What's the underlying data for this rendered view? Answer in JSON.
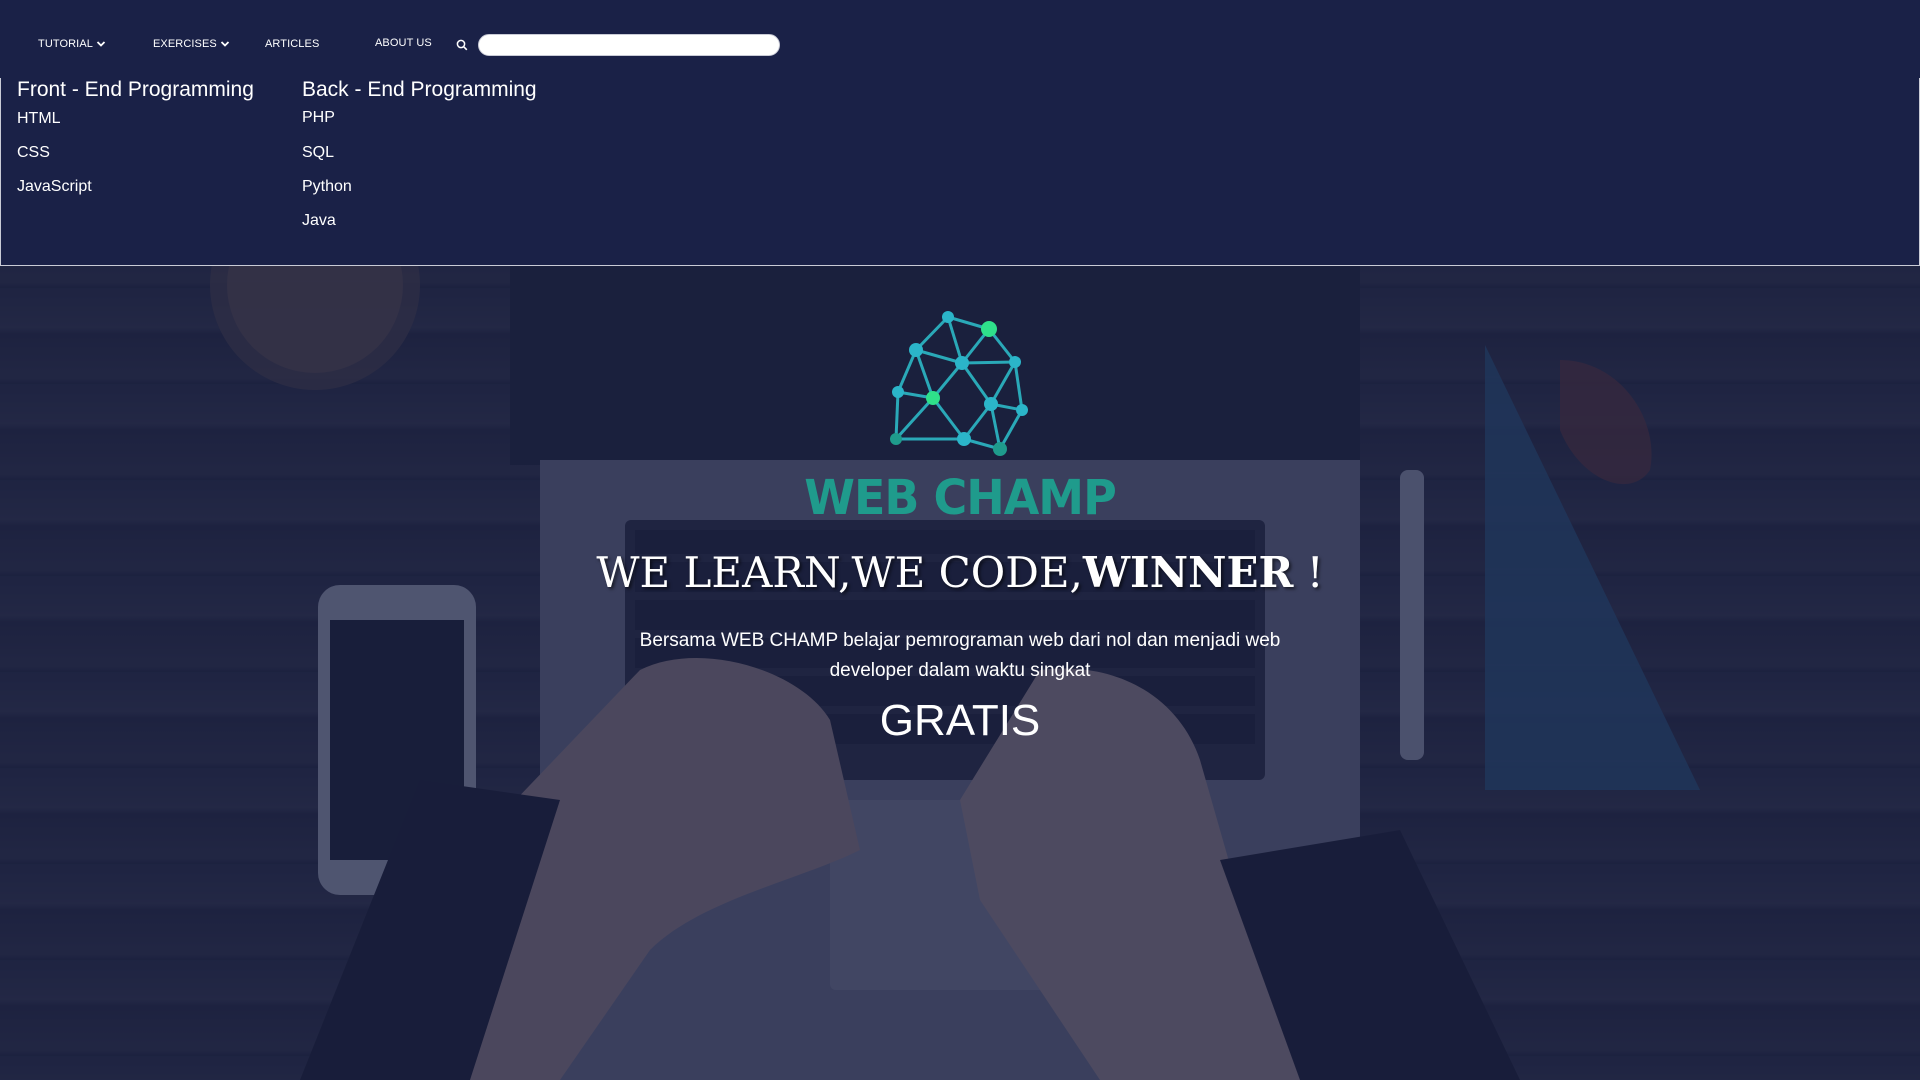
{
  "nav": {
    "items": [
      {
        "label": "TUTORIAL",
        "dropdown": true
      },
      {
        "label": "EXERCISES",
        "dropdown": true
      },
      {
        "label": "ARTICLES",
        "dropdown": false
      },
      {
        "label": "ABOUT US",
        "dropdown": false
      }
    ],
    "search": {
      "icon": "search-icon",
      "value": "",
      "placeholder": ""
    }
  },
  "dropdown": {
    "columns": [
      {
        "heading": "Front - End Programming",
        "links": [
          "HTML",
          "CSS",
          "JavaScript"
        ]
      },
      {
        "heading": "Back - End Programming",
        "links": [
          "PHP",
          "SQL",
          "Python",
          "Java"
        ]
      }
    ]
  },
  "hero": {
    "brand": "WEB CHAMP",
    "headline_regular": "WE LEARN,WE CODE,",
    "headline_bold": "WINNER",
    "headline_end": " !",
    "subtitle": "Bersama WEB CHAMP belajar pemrograman web dari nol dan menjadi web developer dalam waktu singkat",
    "cta": "GRATIS"
  },
  "colors": {
    "nav_bg": "#1a2147",
    "brand_teal": "#1f9b8c",
    "logo_node": "#2bb5c9",
    "logo_accent": "#2fe08a",
    "text": "#ffffff"
  }
}
